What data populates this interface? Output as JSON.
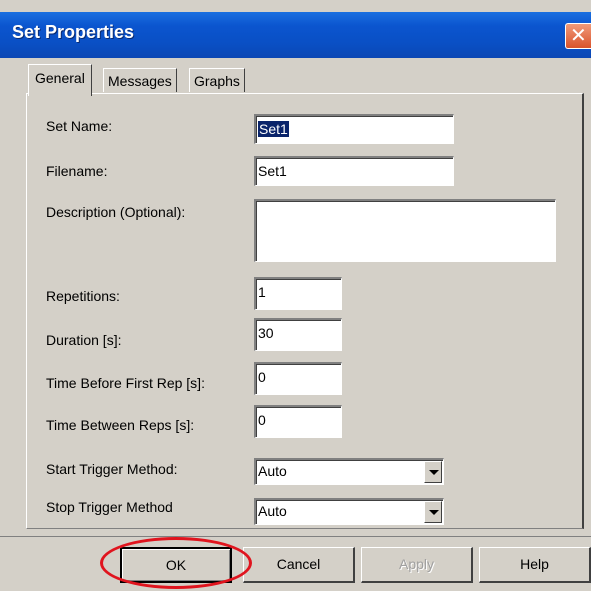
{
  "window": {
    "title": "Set Properties"
  },
  "tabs": [
    {
      "label": "General",
      "active": true
    },
    {
      "label": "Messages",
      "active": false
    },
    {
      "label": "Graphs",
      "active": false
    }
  ],
  "form": {
    "set_name": {
      "label": "Set Name:",
      "value": "Set1"
    },
    "filename": {
      "label": "Filename:",
      "value": "Set1"
    },
    "description": {
      "label": "Description (Optional):",
      "value": ""
    },
    "repetitions": {
      "label": "Repetitions:",
      "value": "1"
    },
    "duration": {
      "label": "Duration [s]:",
      "value": "30"
    },
    "time_before_first_rep": {
      "label": "Time Before First Rep [s]:",
      "value": "0"
    },
    "time_between_reps": {
      "label": "Time Between Reps [s]:",
      "value": "0"
    },
    "start_trigger": {
      "label": "Start Trigger Method:",
      "value": "Auto"
    },
    "stop_trigger": {
      "label": "Stop Trigger Method",
      "value": "Auto"
    }
  },
  "buttons": {
    "ok": "OK",
    "cancel": "Cancel",
    "apply": "Apply",
    "help": "Help"
  },
  "icons": {
    "close": "close-icon",
    "dropdown": "chevron-down-icon"
  },
  "colors": {
    "titlebar": "#0b55cf",
    "highlight": "#e0141e",
    "selection": "#0a246a"
  }
}
